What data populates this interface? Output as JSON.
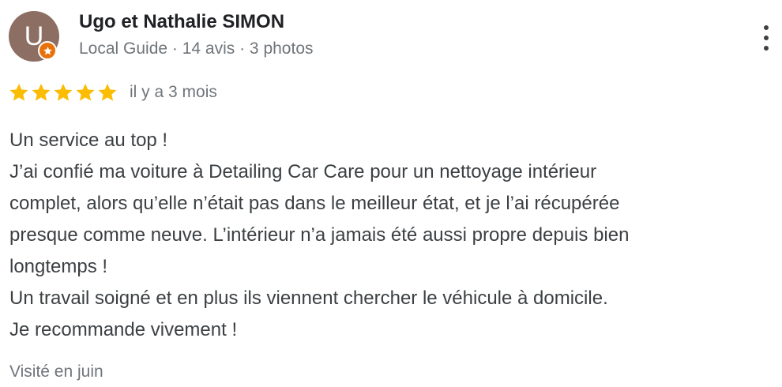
{
  "reviewer": {
    "initial": "U",
    "name": "Ugo et Nathalie SIMON",
    "meta": "Local Guide · 14 avis · 3 photos"
  },
  "review": {
    "rating": 5,
    "max_rating": 5,
    "date": "il y a 3 mois",
    "text_lines": [
      "Un service au top !",
      "J’ai confié ma voiture à Detailing Car Care pour un nettoyage intérieur",
      "complet, alors qu’elle n’était pas dans le meilleur état, et je l’ai récupérée",
      "presque comme neuve. L’intérieur n’a jamais été aussi propre depuis bien",
      "longtemps !",
      "Un travail soigné et en plus ils viennent chercher le véhicule à domicile.",
      "Je recommande vivement !"
    ],
    "visit": "Visité en juin"
  },
  "icons": {
    "more": "more-vert-icon",
    "star": "star-icon",
    "badge": "local-guide-badge-icon"
  },
  "colors": {
    "star": "#fbbc04",
    "avatar": "#8d6e63",
    "badge": "#e8710a",
    "name": "#202124",
    "secondary": "#70757a",
    "body_text": "#3c4043"
  }
}
